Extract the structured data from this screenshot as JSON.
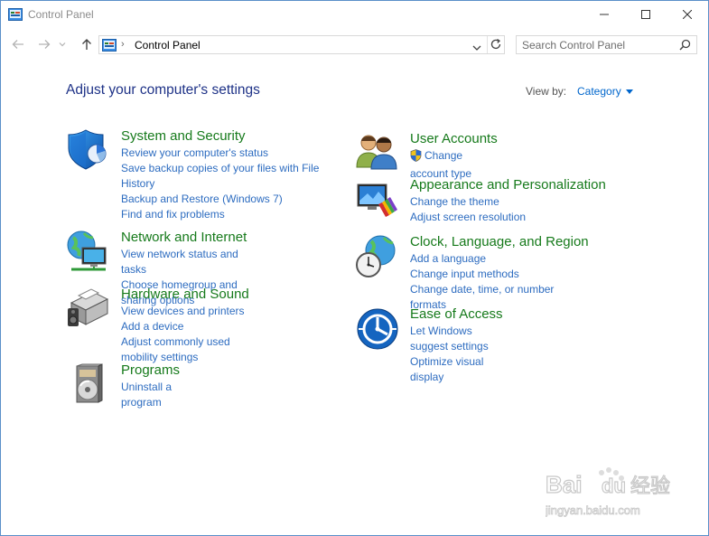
{
  "window": {
    "title": "Control Panel",
    "icons": {
      "app": "control-panel-icon",
      "minimize": "minimize-icon",
      "maximize": "maximize-icon",
      "close": "close-icon"
    }
  },
  "nav": {
    "icons": {
      "back": "back-arrow-icon",
      "forward": "forward-arrow-icon",
      "recent": "chevron-down-icon",
      "up": "up-arrow-icon"
    }
  },
  "address": {
    "separator": "›",
    "crumb": "Control Panel"
  },
  "search": {
    "placeholder": "Search Control Panel",
    "value": ""
  },
  "header": {
    "title": "Adjust your computer's settings",
    "view_by_label": "View by:",
    "view_by_value": "Category"
  },
  "categories": {
    "system": {
      "title": "System and Security",
      "icon": "shield-chart-icon",
      "links": [
        "Review your computer's status",
        "Save backup copies of your files with File History",
        "Backup and Restore (Windows 7)",
        "Find and fix problems"
      ]
    },
    "network": {
      "title": "Network and Internet",
      "icon": "globe-network-icon",
      "links": [
        "View network status and tasks",
        "Choose homegroup and sharing options"
      ]
    },
    "hardware": {
      "title": "Hardware and Sound",
      "icon": "printer-speaker-icon",
      "links": [
        "View devices and printers",
        "Add a device",
        "Adjust commonly used mobility settings"
      ]
    },
    "programs": {
      "title": "Programs",
      "icon": "programs-disc-icon",
      "links": [
        "Uninstall a program"
      ]
    },
    "users": {
      "title": "User Accounts",
      "icon": "user-accounts-icon",
      "links": [
        "Change account type"
      ]
    },
    "appearance": {
      "title": "Appearance and Personalization",
      "icon": "monitor-palette-icon",
      "links": [
        "Change the theme",
        "Adjust screen resolution"
      ]
    },
    "clock": {
      "title": "Clock, Language, and Region",
      "icon": "clock-globe-icon",
      "links": [
        "Add a language",
        "Change input methods",
        "Change date, time, or number formats"
      ]
    },
    "ease": {
      "title": "Ease of Access",
      "icon": "ease-of-access-icon",
      "links": [
        "Let Windows suggest settings",
        "Optimize visual display"
      ]
    }
  },
  "watermark": {
    "brand": "Bai",
    "brand2": "du",
    "cn": "经验",
    "url": "jingyan.baidu.com"
  },
  "colors": {
    "category_title": "#167a1b",
    "link": "#2d6cc0",
    "heading": "#1e3287",
    "window_border": "#5a8fc9"
  }
}
